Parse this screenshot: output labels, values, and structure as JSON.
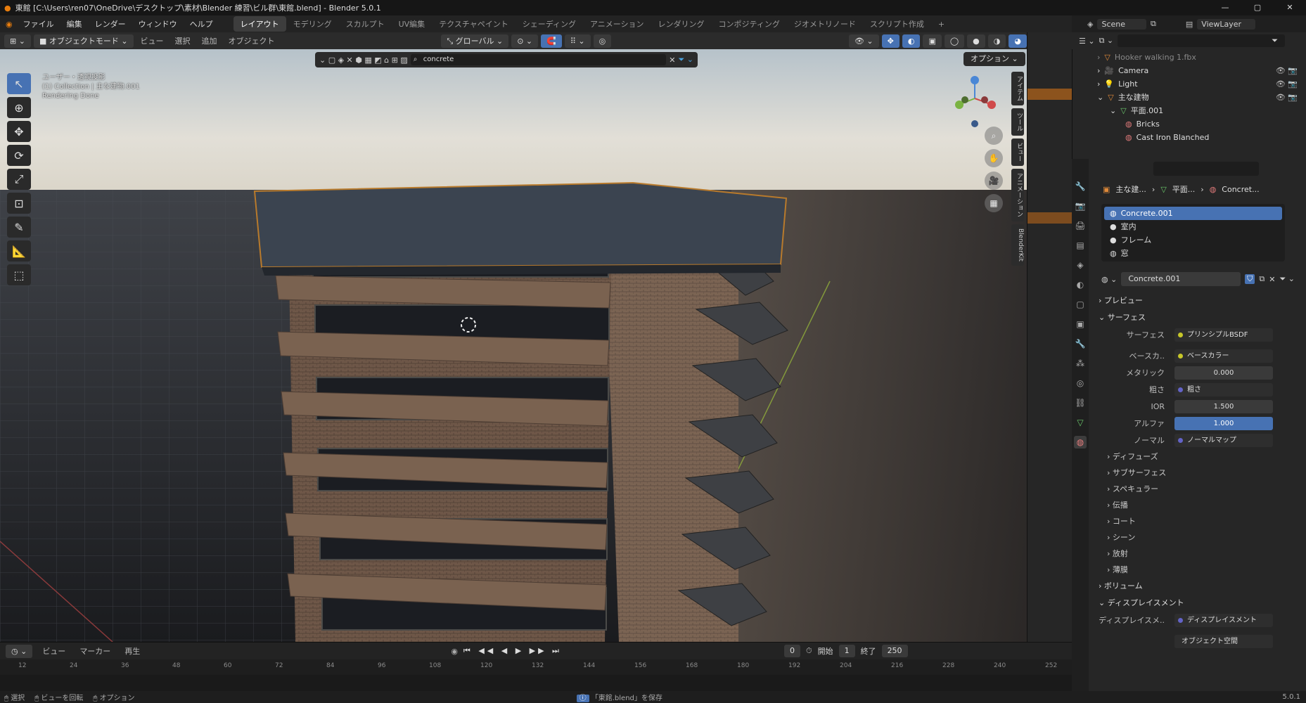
{
  "titlebar": {
    "text": "東館 [C:\\Users\\ren07\\OneDrive\\デスクトップ\\素材\\Blender 練習\\ビル群\\東館.blend] - Blender 5.0.1",
    "minimize": "—",
    "maximize": "▢",
    "close": "✕"
  },
  "menubar": {
    "items": [
      "ファイル",
      "編集",
      "レンダー",
      "ウィンドウ",
      "ヘルプ"
    ],
    "workspaces": [
      "レイアウト",
      "モデリング",
      "スカルプト",
      "UV編集",
      "テクスチャペイント",
      "シェーディング",
      "アニメーション",
      "レンダリング",
      "コンポジティング",
      "ジオメトリノード",
      "スクリプト作成"
    ],
    "active_workspace": "レイアウト",
    "add_tab": "+"
  },
  "viewport_header": {
    "mode": "オブジェクトモード",
    "menus": [
      "ビュー",
      "選択",
      "追加",
      "オブジェクト"
    ],
    "transform": "グローバル"
  },
  "viewport": {
    "info_lines": [
      "ユーザー・透視投影",
      "(1) Collection | 主な建物.001",
      "Rendering Done"
    ],
    "search_value": "concrete",
    "options": "オプション ⌄",
    "side_tabs": [
      "アイテム",
      "ツール",
      "ビュー",
      "アニメーション",
      "BlenderKit"
    ]
  },
  "timeline": {
    "menus": [
      "ビュー",
      "マーカー",
      "再生"
    ],
    "current_frame": "0",
    "start_label": "開始",
    "start": "1",
    "end_label": "終了",
    "end": "250",
    "ticks": [
      "12",
      "24",
      "36",
      "48",
      "60",
      "72",
      "84",
      "96",
      "108",
      "120",
      "132",
      "144",
      "156",
      "168",
      "180",
      "192",
      "204",
      "216",
      "228",
      "240",
      "252"
    ]
  },
  "statusbar": {
    "items": [
      "選択",
      "ビューを回転",
      "オプション"
    ],
    "message": "「東館.blend」を保存",
    "version": "5.0.1"
  },
  "outliner": {
    "scene": "Scene",
    "viewlayer": "ViewLayer",
    "rows": [
      {
        "label": "Hooker walking 1.fbx"
      },
      {
        "label": "Camera"
      },
      {
        "label": "Light"
      },
      {
        "label": "主な建物"
      },
      {
        "label": "平面.001"
      },
      {
        "label": "Bricks"
      },
      {
        "label": "Cast Iron Blanched"
      }
    ]
  },
  "properties": {
    "breadcrumb": [
      "主な建...",
      "平面...",
      "Concret..."
    ],
    "slots": [
      "Concrete.001",
      "室内",
      "フレーム",
      "窓"
    ],
    "material_name": "Concrete.001",
    "sections": {
      "preview": "プレビュー",
      "surface": "サーフェス",
      "volume": "ボリューム",
      "displacement": "ディスプレイスメント"
    },
    "rows": [
      {
        "label": "サーフェス",
        "value": "プリンシプルBSDF"
      },
      {
        "label": "ベースカ..",
        "value": "ベースカラー"
      },
      {
        "label": "メタリック",
        "value": "0.000"
      },
      {
        "label": "粗さ",
        "value": "粗さ"
      },
      {
        "label": "IOR",
        "value": "1.500"
      },
      {
        "label": "アルファ",
        "value": "1.000"
      },
      {
        "label": "ノーマル",
        "value": "ノーマルマップ"
      }
    ],
    "subsections": [
      "ディフューズ",
      "サブサーフェス",
      "スペキュラー",
      "伝播",
      "コート",
      "シーン",
      "放射",
      "薄膜"
    ],
    "displacement_row": {
      "label": "ディスプレイスメ..",
      "value": "ディスプレイスメント"
    },
    "space_value": "オブジェクト空間"
  }
}
